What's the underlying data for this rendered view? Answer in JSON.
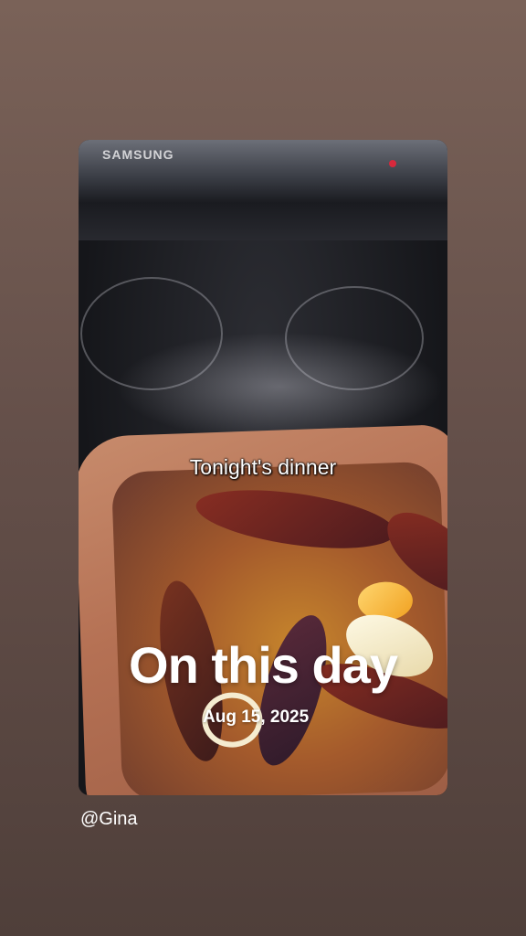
{
  "story": {
    "brand_text": "SAMSUNG",
    "caption": "Tonight's dinner",
    "heading": "On this day",
    "date": "Aug 15, 2025",
    "username": "@Gina"
  },
  "colors": {
    "background": "#6b554d",
    "text": "#ffffff",
    "indicator": "#d8283c"
  }
}
